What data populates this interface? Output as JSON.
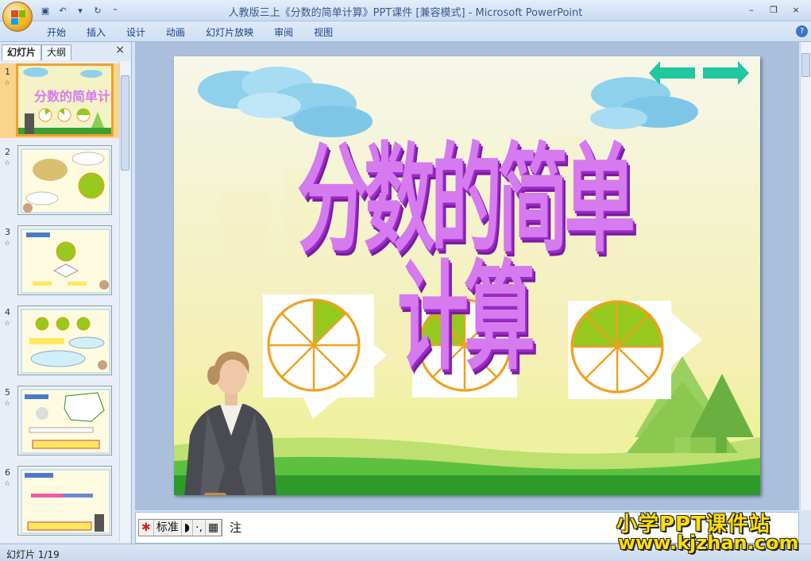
{
  "window": {
    "title": "人教版三上《分数的简单计算》PPT课件 [兼容模式] - Microsoft PowerPoint",
    "controls": [
      "–",
      "❐",
      "×"
    ]
  },
  "ribbon": {
    "tabs": [
      "开始",
      "插入",
      "设计",
      "动画",
      "幻灯片放映",
      "审阅",
      "视图"
    ],
    "help": "?"
  },
  "panel": {
    "tabs": [
      "幻灯片",
      "大纲"
    ],
    "close": "×"
  },
  "thumbnails": [
    {
      "num": "1",
      "star": "☆"
    },
    {
      "num": "2",
      "star": "☆"
    },
    {
      "num": "3",
      "star": "☆"
    },
    {
      "num": "4",
      "star": "☆"
    },
    {
      "num": "5",
      "star": "☆"
    },
    {
      "num": "6",
      "star": "☆"
    }
  ],
  "slide": {
    "title": "分数的简单计算"
  },
  "notes": {
    "text": "注"
  },
  "ime": {
    "items": [
      "标准",
      "◗",
      "·,",
      "▦"
    ]
  },
  "status": {
    "slide_counter": "幻灯片 1/19"
  },
  "watermark": {
    "line1": "小学PPT课件站",
    "line2": "www.kjzhan.com"
  },
  "colors": {
    "pie_fill": "#96c81e",
    "pie_stroke": "#f0a020",
    "arrow": "#20c8a0"
  }
}
